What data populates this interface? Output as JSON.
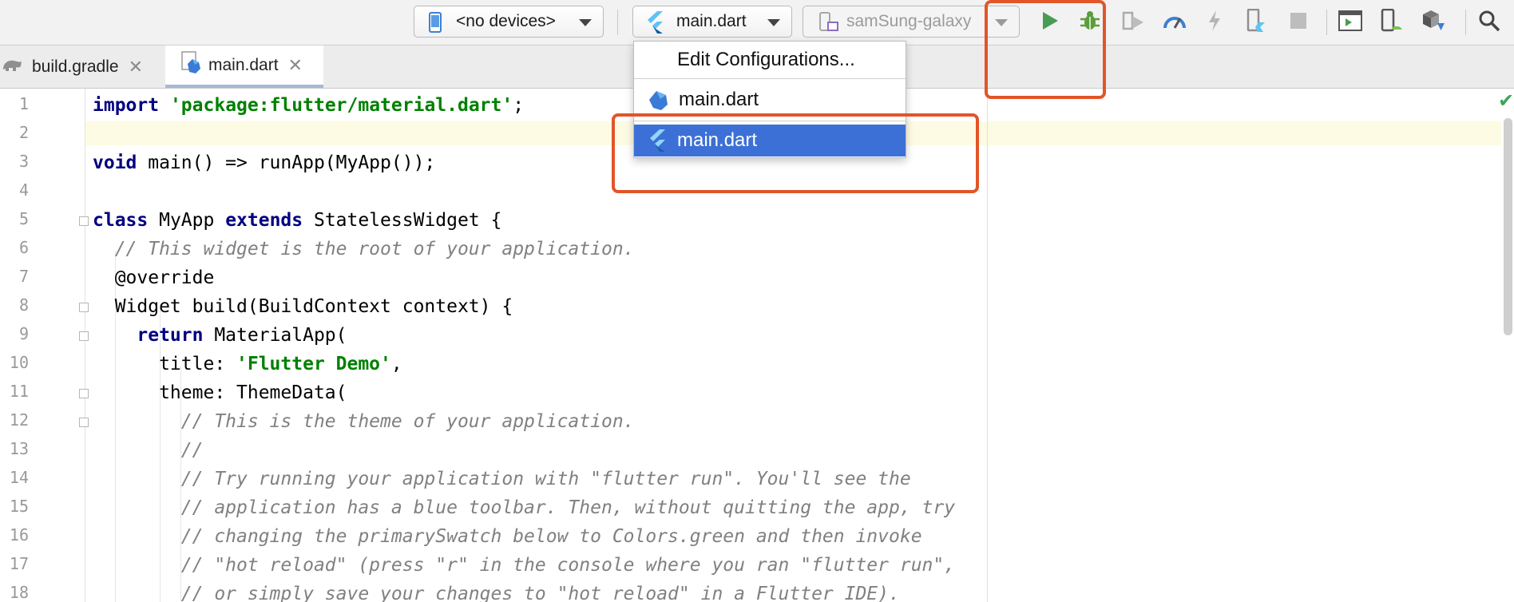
{
  "toolbar": {
    "device_selector": "<no devices>",
    "run_config": "main.dart",
    "target_device": "samSung-galaxy",
    "icons": [
      "phone-icon",
      "flutter-icon",
      "device-icon",
      "run-icon",
      "debug-icon",
      "run-coverage-icon",
      "profile-icon",
      "hot-reload-icon",
      "hot-restart-icon",
      "stop-icon",
      "terminal-icon",
      "avd-manager-icon",
      "sdk-manager-icon",
      "search-icon"
    ],
    "colors": {
      "run": "#499c54",
      "debug": "#5a9e3a",
      "accent": "#3d70d6"
    }
  },
  "tabs": [
    {
      "label": "build.gradle",
      "icon": "gradle-icon",
      "active": false
    },
    {
      "label": "main.dart",
      "icon": "dart-file-icon",
      "active": true
    }
  ],
  "dropdown": {
    "items": [
      {
        "label": "Edit Configurations...",
        "icon": "none",
        "selected": false
      },
      {
        "label": "main.dart",
        "icon": "dart-icon",
        "selected": false
      },
      {
        "label": "main.dart",
        "icon": "flutter-icon",
        "selected": true
      }
    ]
  },
  "editor": {
    "line_numbers": [
      "1",
      "2",
      "3",
      "4",
      "5",
      "6",
      "7",
      "8",
      "9",
      "10",
      "11",
      "12",
      "13",
      "14",
      "15",
      "16",
      "17",
      "18"
    ],
    "lines": [
      {
        "tokens": [
          {
            "t": "import",
            "c": "kw"
          },
          {
            "t": " ",
            "c": ""
          },
          {
            "t": "'package:flutter/material.dart'",
            "c": "str"
          },
          {
            "t": ";",
            "c": ""
          }
        ]
      },
      {
        "tokens": []
      },
      {
        "tokens": [
          {
            "t": "void",
            "c": "kw"
          },
          {
            "t": " main() => runApp(MyApp());",
            "c": ""
          }
        ]
      },
      {
        "tokens": []
      },
      {
        "tokens": [
          {
            "t": "class",
            "c": "kw"
          },
          {
            "t": " MyApp ",
            "c": ""
          },
          {
            "t": "extends",
            "c": "kw"
          },
          {
            "t": " StatelessWidget {",
            "c": ""
          }
        ]
      },
      {
        "tokens": [
          {
            "t": "  // This widget is the root of your application.",
            "c": "cm"
          }
        ]
      },
      {
        "tokens": [
          {
            "t": "  @override",
            "c": ""
          }
        ]
      },
      {
        "tokens": [
          {
            "t": "  Widget build(BuildContext context) {",
            "c": ""
          }
        ]
      },
      {
        "tokens": [
          {
            "t": "    ",
            "c": ""
          },
          {
            "t": "return",
            "c": "kw"
          },
          {
            "t": " MaterialApp(",
            "c": ""
          }
        ]
      },
      {
        "tokens": [
          {
            "t": "      title: ",
            "c": ""
          },
          {
            "t": "'Flutter Demo'",
            "c": "str"
          },
          {
            "t": ",",
            "c": ""
          }
        ]
      },
      {
        "tokens": [
          {
            "t": "      theme: ThemeData(",
            "c": ""
          }
        ]
      },
      {
        "tokens": [
          {
            "t": "        // This is the theme of your application.",
            "c": "cm"
          }
        ]
      },
      {
        "tokens": [
          {
            "t": "        //",
            "c": "cm"
          }
        ]
      },
      {
        "tokens": [
          {
            "t": "        // Try running your application with \"flutter run\". You'll see the",
            "c": "cm"
          }
        ]
      },
      {
        "tokens": [
          {
            "t": "        // application has a blue toolbar. Then, without quitting the app, try",
            "c": "cm"
          }
        ]
      },
      {
        "tokens": [
          {
            "t": "        // changing the primarySwatch below to Colors.green and then invoke",
            "c": "cm"
          }
        ]
      },
      {
        "tokens": [
          {
            "t": "        // \"hot reload\" (press \"r\" in the console where you ran \"flutter run\",",
            "c": "cm"
          }
        ]
      },
      {
        "tokens": [
          {
            "t": "        // or simply save your changes to \"hot reload\" in a Flutter IDE).",
            "c": "cm"
          }
        ]
      }
    ]
  }
}
